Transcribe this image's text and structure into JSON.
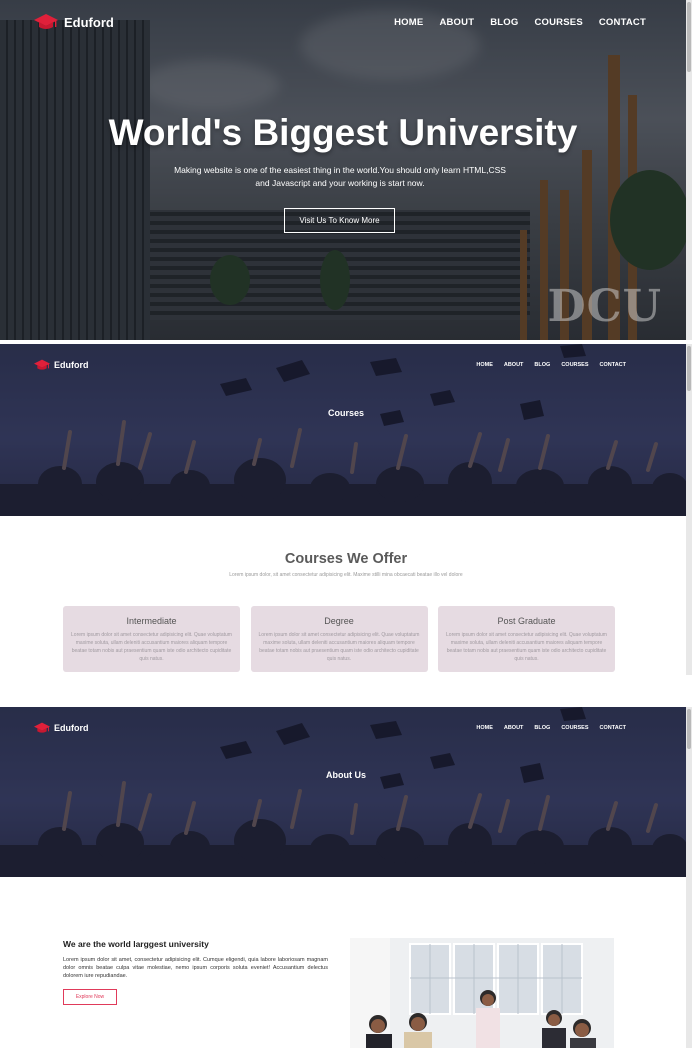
{
  "brand": {
    "name": "Eduford",
    "accent": "#e0203a"
  },
  "nav": {
    "items": [
      "HOME",
      "ABOUT",
      "BLOG",
      "COURSES",
      "CONTACT"
    ]
  },
  "hero": {
    "title": "World's Biggest University",
    "subtitle": "Making website is one of the easiest thing in the world.You should only learn HTML,CSS and Javascript and your working is start now.",
    "button": "Visit Us To Know More",
    "watermark": "DCU"
  },
  "courses_page": {
    "banner_title": "Courses",
    "section_title": "Courses We Offer",
    "section_subtitle": "Lorem ipsum dolor, sit amet consectetur adipisicing elit. Maxime stilli mina obcaecati beatae illo vel dolore",
    "cards": [
      {
        "title": "Intermediate",
        "text": "Lorem ipsum dolor sit amet consectetur adipisicing elit. Quae voluptatum maxime soluta, ullam deleniti accusantium maiores aliquam tempore beatae totam nobis aut praesentium quam iste odio architecto cupiditate quis natus."
      },
      {
        "title": "Degree",
        "text": "Lorem ipsum dolor sit amet consectetur adipisicing elit. Quae voluptatum maxime soluta, ullam deleniti accusantium maiores aliquam tempore beatae totam nobis aut praesentium quam iste odio architecto cupiditate quis natus."
      },
      {
        "title": "Post Graduate",
        "text": "Lorem ipsum dolor sit amet consectetur adipisicing elit. Quae voluptatum maxime soluta, ullam deleniti accusantium maiores aliquam tempore beatae totam nobis aut praesentium quam iste odio architecto cupiditate quis natus."
      }
    ]
  },
  "about_page": {
    "banner_title": "About Us",
    "heading": "We are the world larggest university",
    "text": "Lorem ipsum dolor sit amet, consectetur adipisicing elit. Cumque eligendi, quia labore laboriosam magnam dolor omnis beatae culpa vitae molestiae, nemo ipsum corporis soluta eveniet! Accusantium delectus dolorem iure repudiandae.",
    "button": "Explore Now"
  }
}
